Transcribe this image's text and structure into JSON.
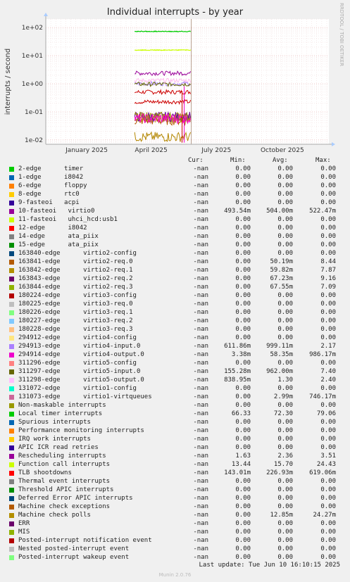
{
  "title": "Individual interrupts - by year",
  "side_label": "RRDTOOL / TOBI OETIKER",
  "footer": {
    "update": "Last update: Tue Jun 10 16:10:15 2025",
    "munin": "Munin 2.0.76"
  },
  "legend_headers": {
    "cur": "Cur:",
    "min": "Min:",
    "avg": "Avg:",
    "max": "Max:"
  },
  "chart_data": {
    "type": "line",
    "title": "Individual interrupts - by year",
    "ylabel": "interrupts / second",
    "yscale": "log",
    "ylim": [
      0.007,
      200
    ],
    "yticks": [
      "1e-02",
      "1e-01",
      "1e+00",
      "1e+01",
      "1e+02"
    ],
    "xticks": [
      "January 2025",
      "April 2025",
      "July 2025",
      "October 2025"
    ],
    "x_range": [
      "2024-11-20",
      "2025-12-20"
    ],
    "data_window": [
      "2025-03-24",
      "2025-06-10"
    ],
    "series": [
      {
        "name": "2-edge timer",
        "color": "#00cc00",
        "level": 72.3
      },
      {
        "name": "10-fasteoi virtio0",
        "color": "#cc0000",
        "level": 0.504
      },
      {
        "name": "11-fasteoi uhci_hcd:usb1",
        "color": "#ccff00",
        "level": 15.7
      },
      {
        "name": "Local timer interrupts",
        "color": "#00cc00",
        "level": 72.3
      },
      {
        "name": "Function call interrupts",
        "color": "#ccff00",
        "level": 15.7
      },
      {
        "name": "Rescheduling interrupts",
        "color": "#990099",
        "level": 2.36
      },
      {
        "name": "TLB shootdowns",
        "color": "#cc0000",
        "level": 0.227
      },
      {
        "name": "294913 virtio4-input.0",
        "color": "#aa88ff",
        "level": 0.999
      },
      {
        "name": "311297 virtio5-input.0",
        "color": "#666600",
        "level": 0.962
      },
      {
        "name": "311298 virtio5-output.0",
        "color": "#ffbbee",
        "level": 1.3
      },
      {
        "name": "131073 virtio1-virtqueues",
        "color": "#cc6699",
        "level": 0.06
      },
      {
        "name": "163841 virtio2-req.0",
        "color": "#b35900",
        "level": 0.05
      },
      {
        "name": "163842 virtio2-req.1",
        "color": "#b3a600",
        "level": 0.06
      },
      {
        "name": "163843 virtio2-req.2",
        "color": "#660099",
        "level": 0.067
      },
      {
        "name": "163844 virtio2-req.3",
        "color": "#999900",
        "level": 0.067
      },
      {
        "name": "294914 virtio4-output.0",
        "color": "#ff00cc",
        "level": 0.058
      },
      {
        "name": "Machine check polls",
        "color": "#b38600",
        "level": 0.0128
      }
    ]
  },
  "rows": [
    {
      "name": "2-edge      timer",
      "color": "#00cc00",
      "cur": "-nan",
      "min": "0.00",
      "avg": "0.00",
      "max": "0.00"
    },
    {
      "name": "1-edge      i8042",
      "color": "#0066b3",
      "cur": "-nan",
      "min": "0.00",
      "avg": "0.00",
      "max": "0.00"
    },
    {
      "name": "6-edge      floppy",
      "color": "#ff8000",
      "cur": "-nan",
      "min": "0.00",
      "avg": "0.00",
      "max": "0.00"
    },
    {
      "name": "8-edge      rtc0",
      "color": "#ffcc00",
      "cur": "-nan",
      "min": "0.00",
      "avg": "0.00",
      "max": "0.00"
    },
    {
      "name": "9-fasteoi   acpi",
      "color": "#330099",
      "cur": "-nan",
      "min": "0.00",
      "avg": "0.00",
      "max": "0.00"
    },
    {
      "name": "10-fasteoi   virtio0",
      "color": "#990099",
      "cur": "-nan",
      "min": "493.54m",
      "avg": "504.00m",
      "max": "522.47m"
    },
    {
      "name": "11-fasteoi   uhci_hcd:usb1",
      "color": "#ccff00",
      "cur": "-nan",
      "min": "0.00",
      "avg": "0.00",
      "max": "0.00"
    },
    {
      "name": "12-edge      i8042",
      "color": "#ff0000",
      "cur": "-nan",
      "min": "0.00",
      "avg": "0.00",
      "max": "0.00"
    },
    {
      "name": "14-edge      ata_piix",
      "color": "#808080",
      "cur": "-nan",
      "min": "0.00",
      "avg": "0.00",
      "max": "0.00"
    },
    {
      "name": "15-edge      ata_piix",
      "color": "#008f00",
      "cur": "-nan",
      "min": "0.00",
      "avg": "0.00",
      "max": "0.00"
    },
    {
      "name": "163840-edge      virtio2-config",
      "color": "#00487d",
      "cur": "-nan",
      "min": "0.00",
      "avg": "0.00",
      "max": "0.00"
    },
    {
      "name": "163841-edge      virtio2-req.0",
      "color": "#b35a00",
      "cur": "-nan",
      "min": "0.00",
      "avg": "50.19m",
      "max": "8.44"
    },
    {
      "name": "163842-edge      virtio2-req.1",
      "color": "#b38f00",
      "cur": "-nan",
      "min": "0.00",
      "avg": "59.82m",
      "max": "7.87"
    },
    {
      "name": "163843-edge      virtio2-req.2",
      "color": "#6b006b",
      "cur": "-nan",
      "min": "0.00",
      "avg": "67.23m",
      "max": "9.16"
    },
    {
      "name": "163844-edge      virtio2-req.3",
      "color": "#8fb300",
      "cur": "-nan",
      "min": "0.00",
      "avg": "67.55m",
      "max": "7.09"
    },
    {
      "name": "180224-edge      virtio3-config",
      "color": "#b30000",
      "cur": "-nan",
      "min": "0.00",
      "avg": "0.00",
      "max": "0.00"
    },
    {
      "name": "180225-edge      virtio3-req.0",
      "color": "#bebebe",
      "cur": "-nan",
      "min": "0.00",
      "avg": "0.00",
      "max": "0.00"
    },
    {
      "name": "180226-edge      virtio3-req.1",
      "color": "#80ff80",
      "cur": "-nan",
      "min": "0.00",
      "avg": "0.00",
      "max": "0.00"
    },
    {
      "name": "180227-edge      virtio3-req.2",
      "color": "#80c9ff",
      "cur": "-nan",
      "min": "0.00",
      "avg": "0.00",
      "max": "0.00"
    },
    {
      "name": "180228-edge      virtio3-req.3",
      "color": "#ffc080",
      "cur": "-nan",
      "min": "0.00",
      "avg": "0.00",
      "max": "0.00"
    },
    {
      "name": "294912-edge      virtio4-config",
      "color": "#ffe680",
      "cur": "-nan",
      "min": "0.00",
      "avg": "0.00",
      "max": "0.00"
    },
    {
      "name": "294913-edge      virtio4-input.0",
      "color": "#aa80ff",
      "cur": "-nan",
      "min": "611.86m",
      "avg": "999.11m",
      "max": "2.17"
    },
    {
      "name": "294914-edge      virtio4-output.0",
      "color": "#ee00cc",
      "cur": "-nan",
      "min": "3.38m",
      "avg": "58.35m",
      "max": "986.17m"
    },
    {
      "name": "311296-edge      virtio5-config",
      "color": "#ff8080",
      "cur": "-nan",
      "min": "0.00",
      "avg": "0.00",
      "max": "0.00"
    },
    {
      "name": "311297-edge      virtio5-input.0",
      "color": "#666600",
      "cur": "-nan",
      "min": "155.28m",
      "avg": "962.00m",
      "max": "7.40"
    },
    {
      "name": "311298-edge      virtio5-output.0",
      "color": "#ffbfff",
      "cur": "-nan",
      "min": "838.95m",
      "avg": "1.30",
      "max": "2.40"
    },
    {
      "name": "131072-edge      virtio1-config",
      "color": "#00ffcc",
      "cur": "-nan",
      "min": "0.00",
      "avg": "0.00",
      "max": "0.00"
    },
    {
      "name": "131073-edge      virtio1-virtqueues",
      "color": "#cc6699",
      "cur": "-nan",
      "min": "0.00",
      "avg": "2.99m",
      "max": "746.17m"
    },
    {
      "name": "Non-maskable interrupts",
      "color": "#999900",
      "cur": "-nan",
      "min": "0.00",
      "avg": "0.00",
      "max": "0.00"
    },
    {
      "name": "Local timer interrupts",
      "color": "#00cc00",
      "cur": "-nan",
      "min": "66.33",
      "avg": "72.30",
      "max": "79.06"
    },
    {
      "name": "Spurious interrupts",
      "color": "#0066b3",
      "cur": "-nan",
      "min": "0.00",
      "avg": "0.00",
      "max": "0.00"
    },
    {
      "name": "Performance monitoring interrupts",
      "color": "#ff8000",
      "cur": "-nan",
      "min": "0.00",
      "avg": "0.00",
      "max": "0.00"
    },
    {
      "name": "IRQ work interrupts",
      "color": "#ffcc00",
      "cur": "-nan",
      "min": "0.00",
      "avg": "0.00",
      "max": "0.00"
    },
    {
      "name": "APIC ICR read retries",
      "color": "#330099",
      "cur": "-nan",
      "min": "0.00",
      "avg": "0.00",
      "max": "0.00"
    },
    {
      "name": "Rescheduling interrupts",
      "color": "#990099",
      "cur": "-nan",
      "min": "1.63",
      "avg": "2.36",
      "max": "3.51"
    },
    {
      "name": "Function call interrupts",
      "color": "#ccff00",
      "cur": "-nan",
      "min": "13.44",
      "avg": "15.70",
      "max": "24.43"
    },
    {
      "name": "TLB shootdowns",
      "color": "#ff0000",
      "cur": "-nan",
      "min": "143.01m",
      "avg": "226.93m",
      "max": "619.06m"
    },
    {
      "name": "Thermal event interrupts",
      "color": "#808080",
      "cur": "-nan",
      "min": "0.00",
      "avg": "0.00",
      "max": "0.00"
    },
    {
      "name": "Threshold APIC interrupts",
      "color": "#008f00",
      "cur": "-nan",
      "min": "0.00",
      "avg": "0.00",
      "max": "0.00"
    },
    {
      "name": "Deferred Error APIC interrupts",
      "color": "#00487d",
      "cur": "-nan",
      "min": "0.00",
      "avg": "0.00",
      "max": "0.00"
    },
    {
      "name": "Machine check exceptions",
      "color": "#b35a00",
      "cur": "-nan",
      "min": "0.00",
      "avg": "0.00",
      "max": "0.00"
    },
    {
      "name": "Machine check polls",
      "color": "#b38f00",
      "cur": "-nan",
      "min": "0.00",
      "avg": "12.85m",
      "max": "24.27m"
    },
    {
      "name": "ERR",
      "color": "#6b006b",
      "cur": "-nan",
      "min": "0.00",
      "avg": "0.00",
      "max": "0.00"
    },
    {
      "name": "MIS",
      "color": "#8fb300",
      "cur": "-nan",
      "min": "0.00",
      "avg": "0.00",
      "max": "0.00"
    },
    {
      "name": "Posted-interrupt notification event",
      "color": "#b30000",
      "cur": "-nan",
      "min": "0.00",
      "avg": "0.00",
      "max": "0.00"
    },
    {
      "name": "Nested posted-interrupt event",
      "color": "#bebebe",
      "cur": "-nan",
      "min": "0.00",
      "avg": "0.00",
      "max": "0.00"
    },
    {
      "name": "Posted-interrupt wakeup event",
      "color": "#80ff80",
      "cur": "-nan",
      "min": "0.00",
      "avg": "0.00",
      "max": "0.00"
    }
  ]
}
